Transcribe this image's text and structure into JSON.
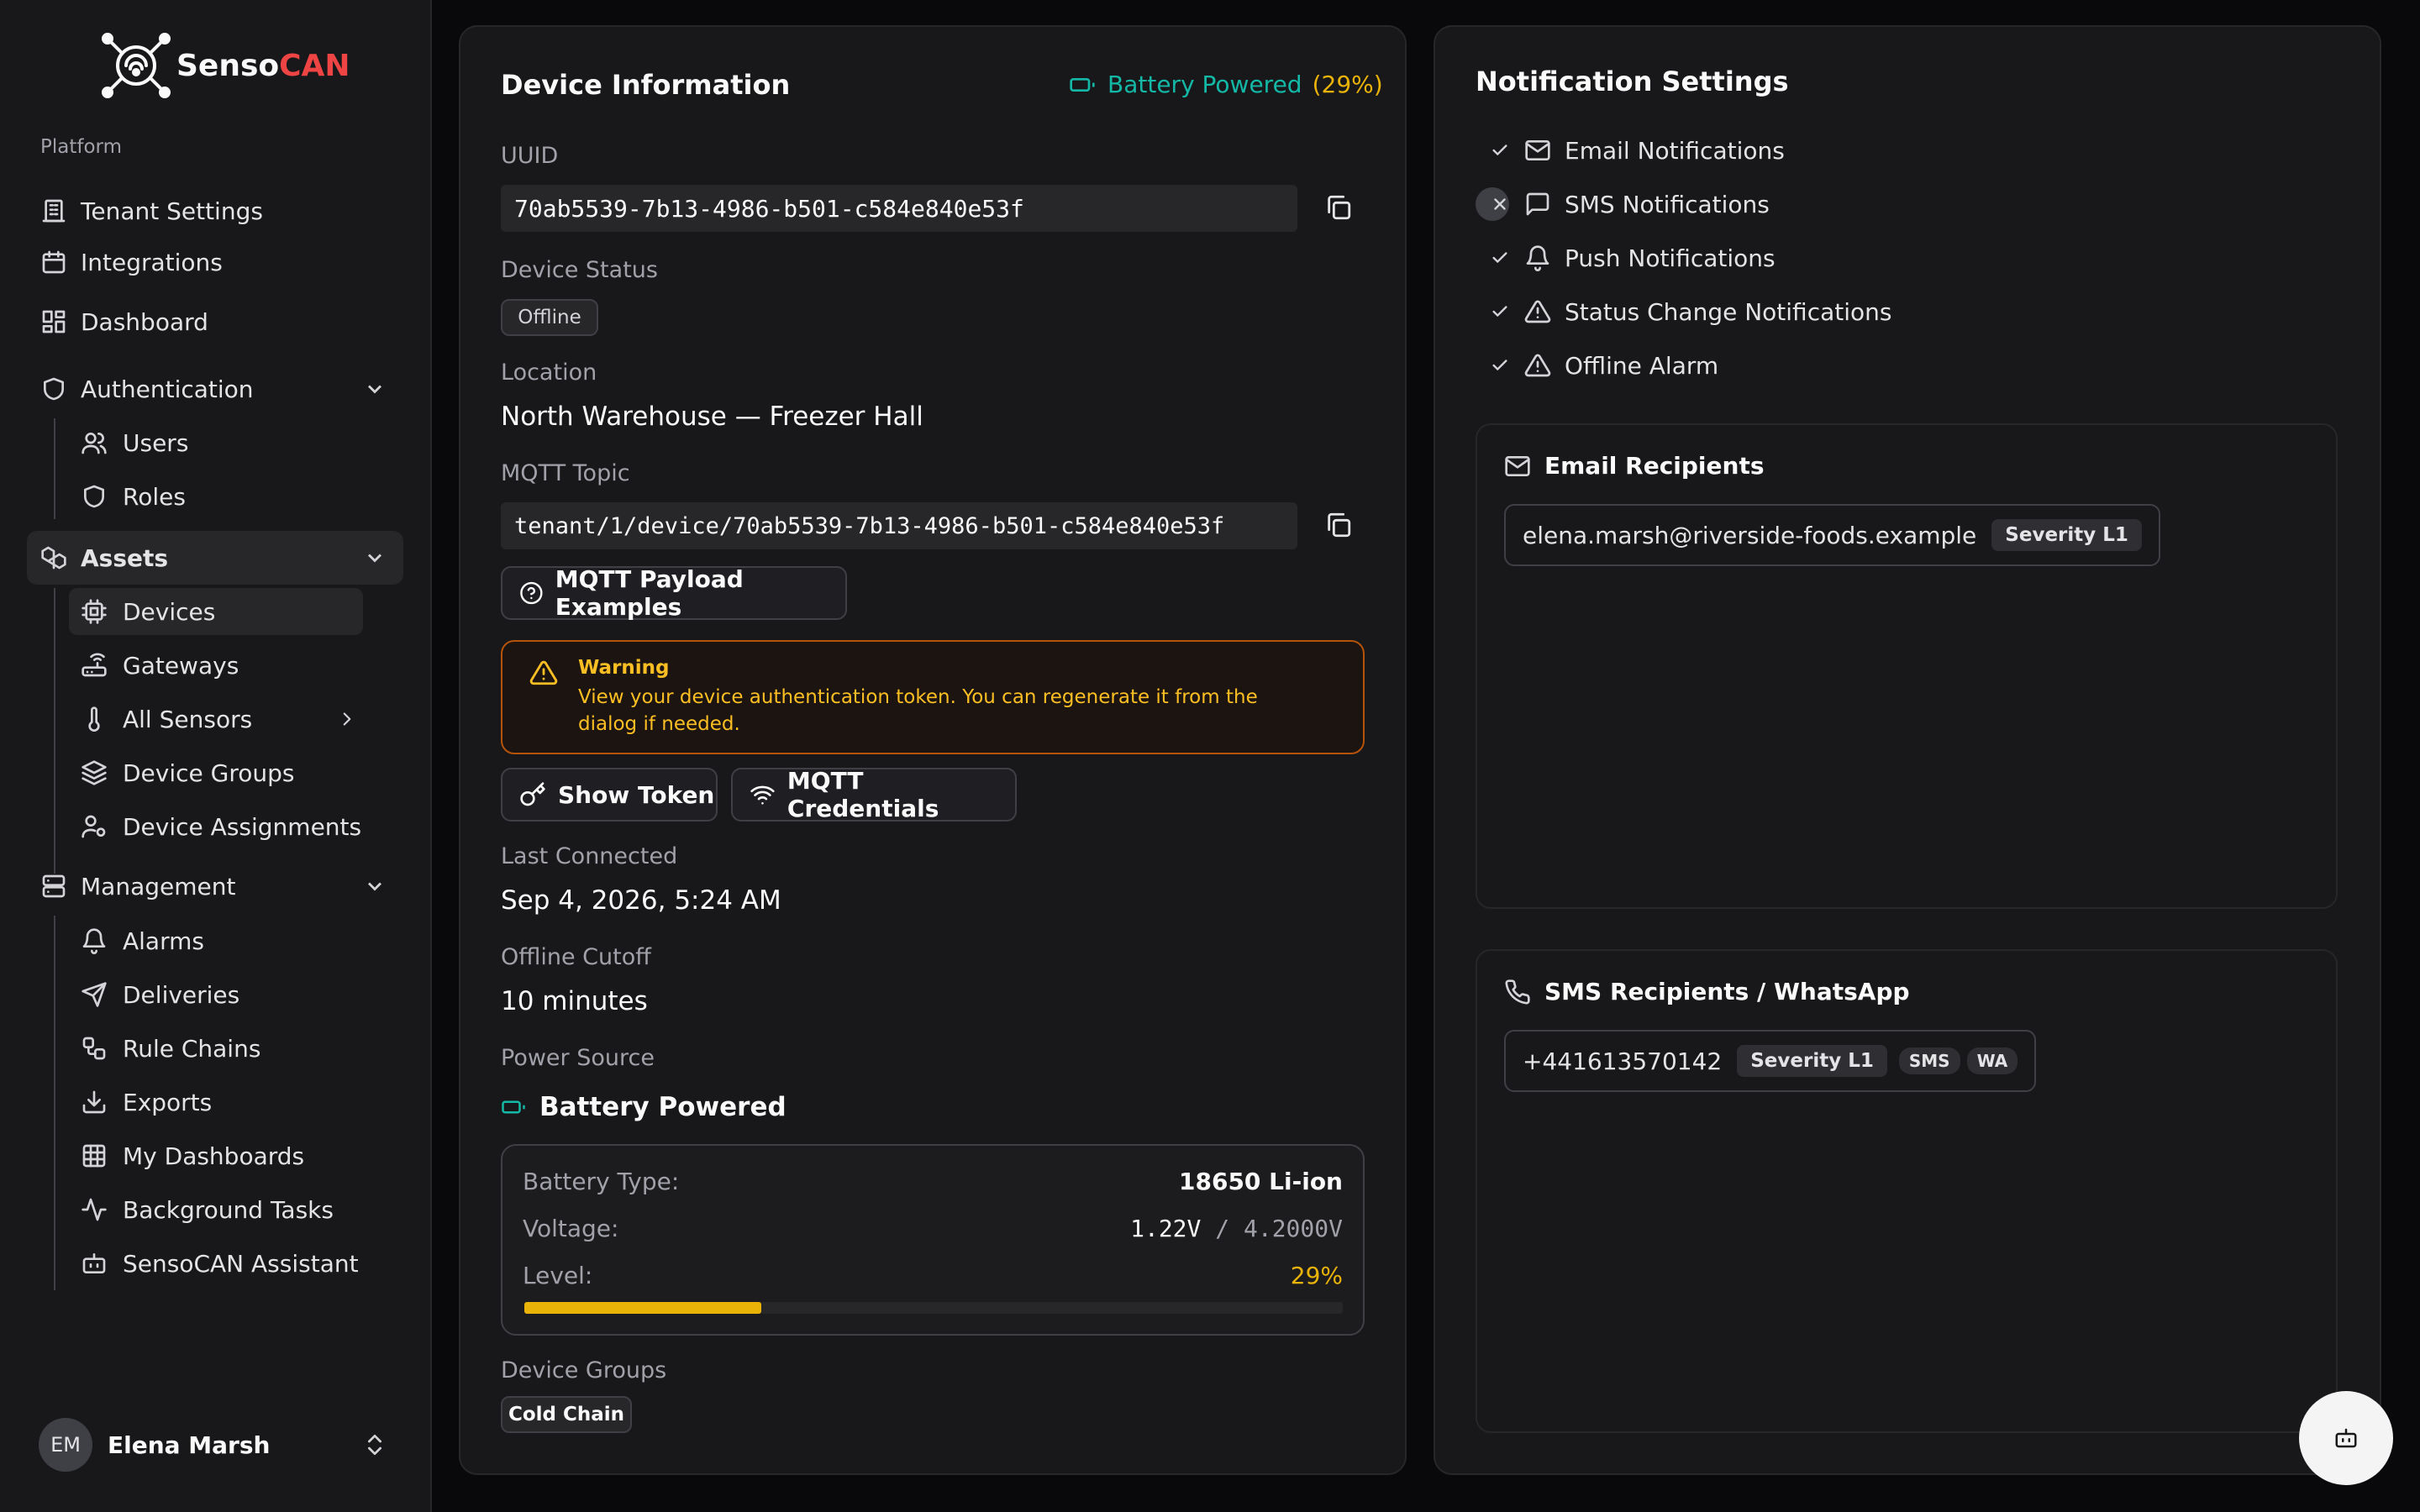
{
  "brand": {
    "name_part1": "Senso",
    "name_part2": "CAN",
    "accent": "#ef4444"
  },
  "sidebar": {
    "group_label": "Platform",
    "items": {
      "tenant_settings": "Tenant Settings",
      "integrations": "Integrations",
      "dashboard": "Dashboard",
      "authentication": "Authentication",
      "users": "Users",
      "roles": "Roles",
      "assets": "Assets",
      "devices": "Devices",
      "gateways": "Gateways",
      "all_sensors": "All Sensors",
      "device_groups": "Device Groups",
      "device_assignments": "Device Assignments",
      "management": "Management",
      "alarms": "Alarms",
      "deliveries": "Deliveries",
      "rule_chains": "Rule Chains",
      "exports": "Exports",
      "my_dashboards": "My Dashboards",
      "background_tasks": "Background Tasks",
      "assistant": "SensoCAN Assistant"
    },
    "user": {
      "initials": "EM",
      "name": "Elena Marsh"
    }
  },
  "device": {
    "title": "Device Information",
    "power_header": "Battery Powered",
    "power_header_pct": "(29%)",
    "uuid_label": "UUID",
    "uuid": "70ab5539-7b13-4986-b501-c584e840e53f",
    "status_label": "Device Status",
    "status": "Offline",
    "location_label": "Location",
    "location": "North Warehouse — Freezer Hall",
    "mqtt_label": "MQTT Topic",
    "mqtt_topic": "tenant/1/device/70ab5539-7b13-4986-b501-c584e840e53f",
    "payload_btn": "MQTT Payload Examples",
    "warning_title": "Warning",
    "warning_msg": "View your device authentication token. You can regenerate it from the dialog if needed.",
    "show_token_btn": "Show Token",
    "mqtt_creds_btn": "MQTT Credentials",
    "last_connected_label": "Last Connected",
    "last_connected": "Sep 4, 2026, 5:24 AM",
    "offline_cutoff_label": "Offline Cutoff",
    "offline_cutoff": "10 minutes",
    "power_source_label": "Power Source",
    "power_source": "Battery Powered",
    "battery": {
      "type_label": "Battery Type:",
      "type": "18650 Li-ion",
      "voltage_label": "Voltage:",
      "voltage": "1.22V",
      "voltage_sep": "/",
      "voltage_max": "4.2000V",
      "level_label": "Level:",
      "level_text": "29%",
      "level_fraction": 0.29,
      "level_color": "#eab308"
    },
    "groups_label": "Device Groups",
    "group_badge": "Cold Chain"
  },
  "notifications": {
    "title": "Notification Settings",
    "items": [
      {
        "label": "Email Notifications",
        "enabled": true,
        "icon": "mail-icon"
      },
      {
        "label": "SMS Notifications",
        "enabled": false,
        "icon": "message-icon"
      },
      {
        "label": "Push Notifications",
        "enabled": true,
        "icon": "bell-icon"
      },
      {
        "label": "Status Change Notifications",
        "enabled": true,
        "icon": "alert-triangle-icon"
      },
      {
        "label": "Offline Alarm",
        "enabled": true,
        "icon": "alert-triangle-icon"
      }
    ],
    "email": {
      "title": "Email Recipients",
      "address": "elena.marsh@riverside-foods.example",
      "severity": "Severity L1"
    },
    "sms": {
      "title": "SMS Recipients / WhatsApp",
      "phone": "+441613570142",
      "severity": "Severity L1",
      "tag_sms": "SMS",
      "tag_wa": "WA"
    }
  },
  "colors": {
    "enabled_check": "#22c55e",
    "battery_teal": "#14b8a6",
    "warning": "#fbbf24"
  }
}
